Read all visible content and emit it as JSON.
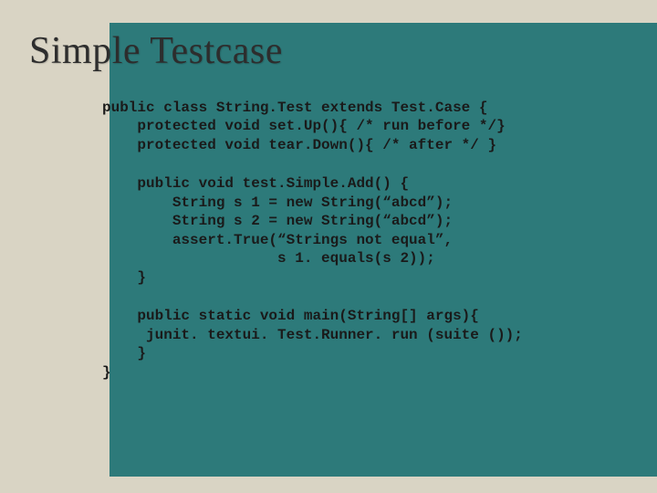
{
  "slide": {
    "title": "Simple Testcase",
    "code": {
      "block1_line1": "public class String.Test extends Test.Case {",
      "block1_line2": "    protected void set.Up(){ /* run before */}",
      "block1_line3": "    protected void tear.Down(){ /* after */ }",
      "block2_line1": "    public void test.Simple.Add() {",
      "block2_line2": "        String s 1 = new String(“abcd”);",
      "block2_line3": "        String s 2 = new String(“abcd”);",
      "block2_line4": "        assert.True(“Strings not equal”,",
      "block2_line5": "                    s 1. equals(s 2));",
      "block2_line6": "    }",
      "block3_line1": "    public static void main(String[] args){",
      "block3_line2": "     junit. textui. Test.Runner. run (suite ());",
      "block3_line3": "    }",
      "block3_line4": "}"
    }
  },
  "colors": {
    "bg_teal": "#2d7a7a",
    "bg_khaki": "#d9d4c4"
  }
}
